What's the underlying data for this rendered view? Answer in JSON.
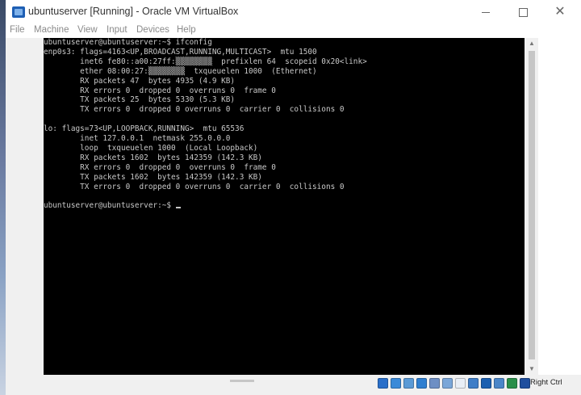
{
  "window": {
    "title": "ubuntuserver [Running] - Oracle VM VirtualBox"
  },
  "menu": {
    "items": [
      "File",
      "Machine",
      "View",
      "Input",
      "Devices",
      "Help"
    ]
  },
  "terminal": {
    "lines": [
      "ubuntuserver@ubuntuserver:~$ ifconfig",
      "enp0s3: flags=4163<UP,BROADCAST,RUNNING,MULTICAST>  mtu 1500",
      "        inet6 fe80::a00:27ff:▒▒▒▒▒▒▒▒  prefixlen 64  scopeid 0x20<link>",
      "        ether 08:00:27:▒▒▒▒▒▒▒▒  txqueuelen 1000  (Ethernet)",
      "        RX packets 47  bytes 4935 (4.9 KB)",
      "        RX errors 0  dropped 0  overruns 0  frame 0",
      "        TX packets 25  bytes 5330 (5.3 KB)",
      "        TX errors 0  dropped 0 overruns 0  carrier 0  collisions 0",
      "",
      "lo: flags=73<UP,LOOPBACK,RUNNING>  mtu 65536",
      "        inet 127.0.0.1  netmask 255.0.0.0",
      "        loop  txqueuelen 1000  (Local Loopback)",
      "        RX packets 1602  bytes 142359 (142.3 KB)",
      "        RX errors 0  dropped 0  overruns 0  frame 0",
      "        TX packets 1602  bytes 142359 (142.3 KB)",
      "        TX errors 0  dropped 0 overruns 0  carrier 0  collisions 0",
      "",
      "ubuntuserver@ubuntuserver:~$ "
    ]
  },
  "statusbar": {
    "host_key": "Right Ctrl",
    "icons": [
      {
        "name": "hard-disk-icon",
        "color": "#2a6fc9"
      },
      {
        "name": "optical-drive-icon",
        "color": "#3b8ad8"
      },
      {
        "name": "audio-icon",
        "color": "#5a9ad6"
      },
      {
        "name": "network-icon",
        "color": "#2f7fd0"
      },
      {
        "name": "usb-icon",
        "color": "#6e8fc4"
      },
      {
        "name": "shared-folders-icon",
        "color": "#7aa6d8"
      },
      {
        "name": "display-icon",
        "color": "#e8eef6"
      },
      {
        "name": "video-capture-icon",
        "color": "#3f7ec7"
      },
      {
        "name": "recording-icon",
        "color": "#1b5fb0"
      },
      {
        "name": "cpu-icon",
        "color": "#4b86c8"
      },
      {
        "name": "mouse-integration-icon",
        "color": "#2a8f4a"
      },
      {
        "name": "host-key-arrow-icon",
        "color": "#1f4f9e"
      }
    ]
  }
}
